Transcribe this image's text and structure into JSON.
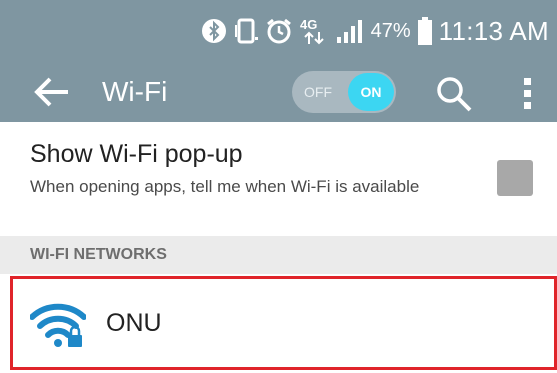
{
  "status_bar": {
    "network_type": "4G",
    "battery_percent": "47%",
    "time": "11:13 AM",
    "icons": [
      "bluetooth-icon",
      "vibrate-icon",
      "alarm-icon",
      "lte-icon",
      "signal-icon",
      "battery-icon"
    ]
  },
  "action_bar": {
    "back_icon": "back-arrow-icon",
    "title": "Wi-Fi",
    "toggle": {
      "off_label": "OFF",
      "on_label": "ON",
      "state": "on"
    },
    "search_icon": "search-icon",
    "overflow_icon": "overflow-menu-icon"
  },
  "popup_setting": {
    "title": "Show Wi-Fi pop-up",
    "description": "When opening apps, tell me when Wi-Fi is available",
    "checked": false
  },
  "networks_section": {
    "header": "WI-FI NETWORKS",
    "networks": [
      {
        "name": "ONU",
        "icon": "wifi-secured-icon",
        "highlighted": true
      }
    ]
  },
  "colors": {
    "toolbar": "#7f96a1",
    "toggle_on": "#3cd6f2",
    "highlight_border": "#e0242a",
    "wifi_icon": "#1e88c8"
  }
}
